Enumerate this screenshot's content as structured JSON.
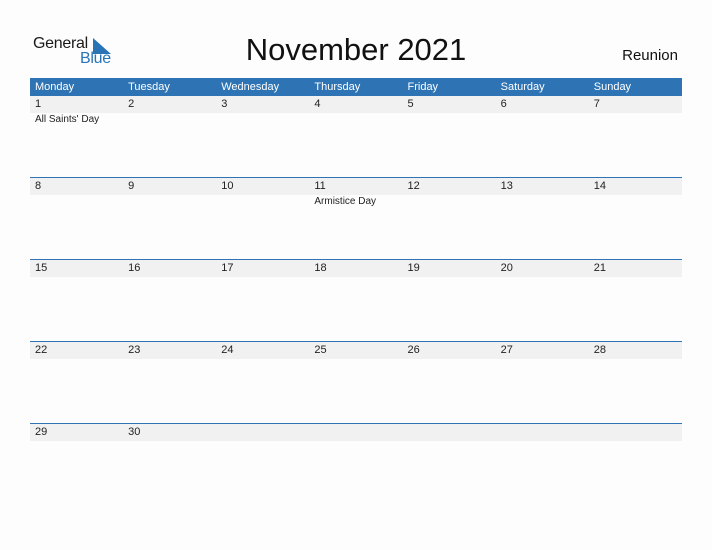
{
  "logo": {
    "word1": "General",
    "word2": "Blue",
    "accent_color": "#2a74b5"
  },
  "title": "November 2021",
  "region": "Reunion",
  "colors": {
    "header_bg": "#2e74b5",
    "date_band": "#f1f1f1"
  },
  "weekdays": [
    "Monday",
    "Tuesday",
    "Wednesday",
    "Thursday",
    "Friday",
    "Saturday",
    "Sunday"
  ],
  "weeks": [
    [
      {
        "day": "1",
        "holiday": "All Saints' Day"
      },
      {
        "day": "2",
        "holiday": ""
      },
      {
        "day": "3",
        "holiday": ""
      },
      {
        "day": "4",
        "holiday": ""
      },
      {
        "day": "5",
        "holiday": ""
      },
      {
        "day": "6",
        "holiday": ""
      },
      {
        "day": "7",
        "holiday": ""
      }
    ],
    [
      {
        "day": "8",
        "holiday": ""
      },
      {
        "day": "9",
        "holiday": ""
      },
      {
        "day": "10",
        "holiday": ""
      },
      {
        "day": "11",
        "holiday": "Armistice Day"
      },
      {
        "day": "12",
        "holiday": ""
      },
      {
        "day": "13",
        "holiday": ""
      },
      {
        "day": "14",
        "holiday": ""
      }
    ],
    [
      {
        "day": "15",
        "holiday": ""
      },
      {
        "day": "16",
        "holiday": ""
      },
      {
        "day": "17",
        "holiday": ""
      },
      {
        "day": "18",
        "holiday": ""
      },
      {
        "day": "19",
        "holiday": ""
      },
      {
        "day": "20",
        "holiday": ""
      },
      {
        "day": "21",
        "holiday": ""
      }
    ],
    [
      {
        "day": "22",
        "holiday": ""
      },
      {
        "day": "23",
        "holiday": ""
      },
      {
        "day": "24",
        "holiday": ""
      },
      {
        "day": "25",
        "holiday": ""
      },
      {
        "day": "26",
        "holiday": ""
      },
      {
        "day": "27",
        "holiday": ""
      },
      {
        "day": "28",
        "holiday": ""
      }
    ],
    [
      {
        "day": "29",
        "holiday": ""
      },
      {
        "day": "30",
        "holiday": ""
      },
      {
        "day": "",
        "holiday": ""
      },
      {
        "day": "",
        "holiday": ""
      },
      {
        "day": "",
        "holiday": ""
      },
      {
        "day": "",
        "holiday": ""
      },
      {
        "day": "",
        "holiday": ""
      }
    ]
  ]
}
